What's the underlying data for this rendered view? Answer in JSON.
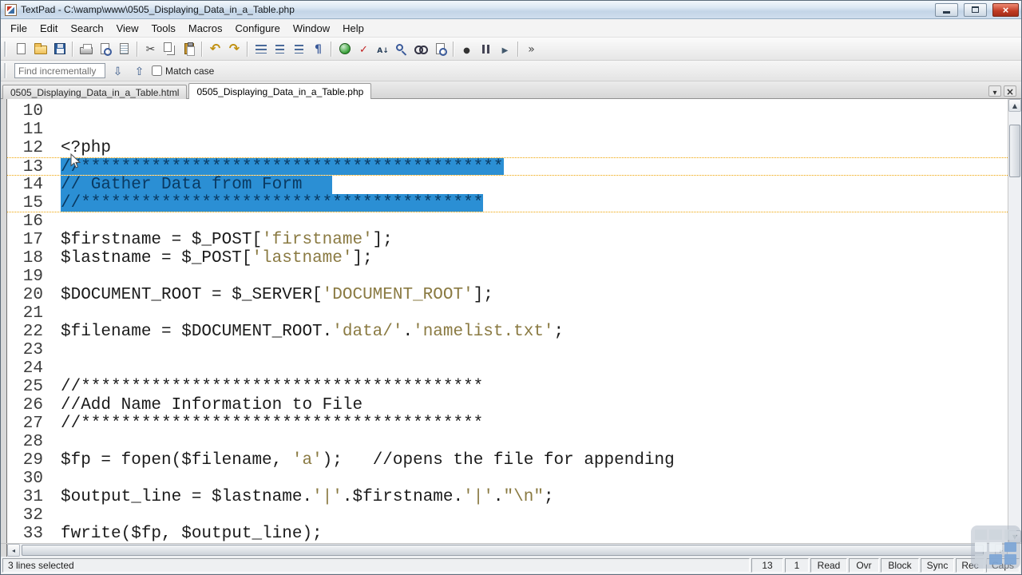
{
  "window": {
    "title": "TextPad - C:\\wamp\\www\\0505_Displaying_Data_in_a_Table.php",
    "controls": [
      "minimize",
      "maximize",
      "close"
    ]
  },
  "menu": {
    "items": [
      "File",
      "Edit",
      "Search",
      "View",
      "Tools",
      "Macros",
      "Configure",
      "Window",
      "Help"
    ]
  },
  "toolbar": {
    "icons": [
      "new-document",
      "open-file",
      "save-file",
      "print",
      "print-preview",
      "document-properties",
      "cut",
      "copy",
      "paste",
      "undo",
      "redo",
      "reformat",
      "indent",
      "unindent",
      "show-formatting",
      "view-in-web-browser",
      "spell-check",
      "sort",
      "find",
      "view-file",
      "find-in-files",
      "record-macro",
      "pause-macro",
      "play-macro",
      "toolbar-options"
    ]
  },
  "findbar": {
    "placeholder": "Find incrementally",
    "match_case_label": "Match case",
    "buttons": [
      "find-next",
      "find-previous"
    ]
  },
  "tabs": [
    {
      "label": "0505_Displaying_Data_in_a_Table.html",
      "active": false
    },
    {
      "label": "0505_Displaying_Data_in_a_Table.php",
      "active": true
    }
  ],
  "editor": {
    "colors": {
      "plain": "#1b1b1b",
      "string": "#8a7a42",
      "selection_bg": "#2b8fd4",
      "selection_text": "#0a3a62",
      "highlight_dotted": "#efa300"
    },
    "lines": [
      {
        "num": "10",
        "segments": []
      },
      {
        "num": "11",
        "segments": []
      },
      {
        "num": "12",
        "segments": [
          {
            "t": "plain",
            "x": "<?php"
          }
        ]
      },
      {
        "num": "13",
        "selected": true,
        "segments": [
          {
            "t": "comment",
            "x": "//******************************************"
          }
        ]
      },
      {
        "num": "14",
        "selected": true,
        "segments": [
          {
            "t": "comment",
            "x": "// Gather Data from Form   "
          }
        ]
      },
      {
        "num": "15",
        "selected": true,
        "segments": [
          {
            "t": "comment",
            "x": "//****************************************"
          }
        ]
      },
      {
        "num": "16",
        "segments": []
      },
      {
        "num": "17",
        "segments": [
          {
            "t": "plain",
            "x": "$firstname = $_POST["
          },
          {
            "t": "string",
            "x": "'firstname'"
          },
          {
            "t": "plain",
            "x": "];"
          }
        ]
      },
      {
        "num": "18",
        "segments": [
          {
            "t": "plain",
            "x": "$lastname = $_POST["
          },
          {
            "t": "string",
            "x": "'lastname'"
          },
          {
            "t": "plain",
            "x": "];"
          }
        ]
      },
      {
        "num": "19",
        "segments": []
      },
      {
        "num": "20",
        "segments": [
          {
            "t": "plain",
            "x": "$DOCUMENT_ROOT = $_SERVER["
          },
          {
            "t": "string",
            "x": "'DOCUMENT_ROOT'"
          },
          {
            "t": "plain",
            "x": "];"
          }
        ]
      },
      {
        "num": "21",
        "segments": []
      },
      {
        "num": "22",
        "segments": [
          {
            "t": "plain",
            "x": "$filename = $DOCUMENT_ROOT."
          },
          {
            "t": "string",
            "x": "'data/'"
          },
          {
            "t": "plain",
            "x": "."
          },
          {
            "t": "string",
            "x": "'namelist.txt'"
          },
          {
            "t": "plain",
            "x": ";"
          }
        ]
      },
      {
        "num": "23",
        "segments": []
      },
      {
        "num": "24",
        "segments": []
      },
      {
        "num": "25",
        "segments": [
          {
            "t": "comment",
            "x": "//****************************************"
          }
        ]
      },
      {
        "num": "26",
        "segments": [
          {
            "t": "comment",
            "x": "//Add Name Information to File"
          }
        ]
      },
      {
        "num": "27",
        "segments": [
          {
            "t": "comment",
            "x": "//****************************************"
          }
        ]
      },
      {
        "num": "28",
        "segments": []
      },
      {
        "num": "29",
        "segments": [
          {
            "t": "plain",
            "x": "$fp = fopen($filename, "
          },
          {
            "t": "string",
            "x": "'a'"
          },
          {
            "t": "plain",
            "x": ");   "
          },
          {
            "t": "comment",
            "x": "//opens the file for appending"
          }
        ]
      },
      {
        "num": "30",
        "segments": []
      },
      {
        "num": "31",
        "segments": [
          {
            "t": "plain",
            "x": "$output_line = $lastname."
          },
          {
            "t": "string",
            "x": "'|'"
          },
          {
            "t": "plain",
            "x": ".$firstname."
          },
          {
            "t": "string",
            "x": "'|'"
          },
          {
            "t": "plain",
            "x": "."
          },
          {
            "t": "string",
            "x": "\"\\n\""
          },
          {
            "t": "plain",
            "x": ";"
          }
        ]
      },
      {
        "num": "32",
        "segments": []
      },
      {
        "num": "33",
        "segments": [
          {
            "t": "plain",
            "x": "fwrite($fp, $output_line);"
          }
        ]
      }
    ]
  },
  "status": {
    "message": "3 lines selected",
    "cells": [
      "13",
      "1",
      "Read",
      "Ovr",
      "Block",
      "Sync",
      "Rec",
      "Caps"
    ]
  }
}
